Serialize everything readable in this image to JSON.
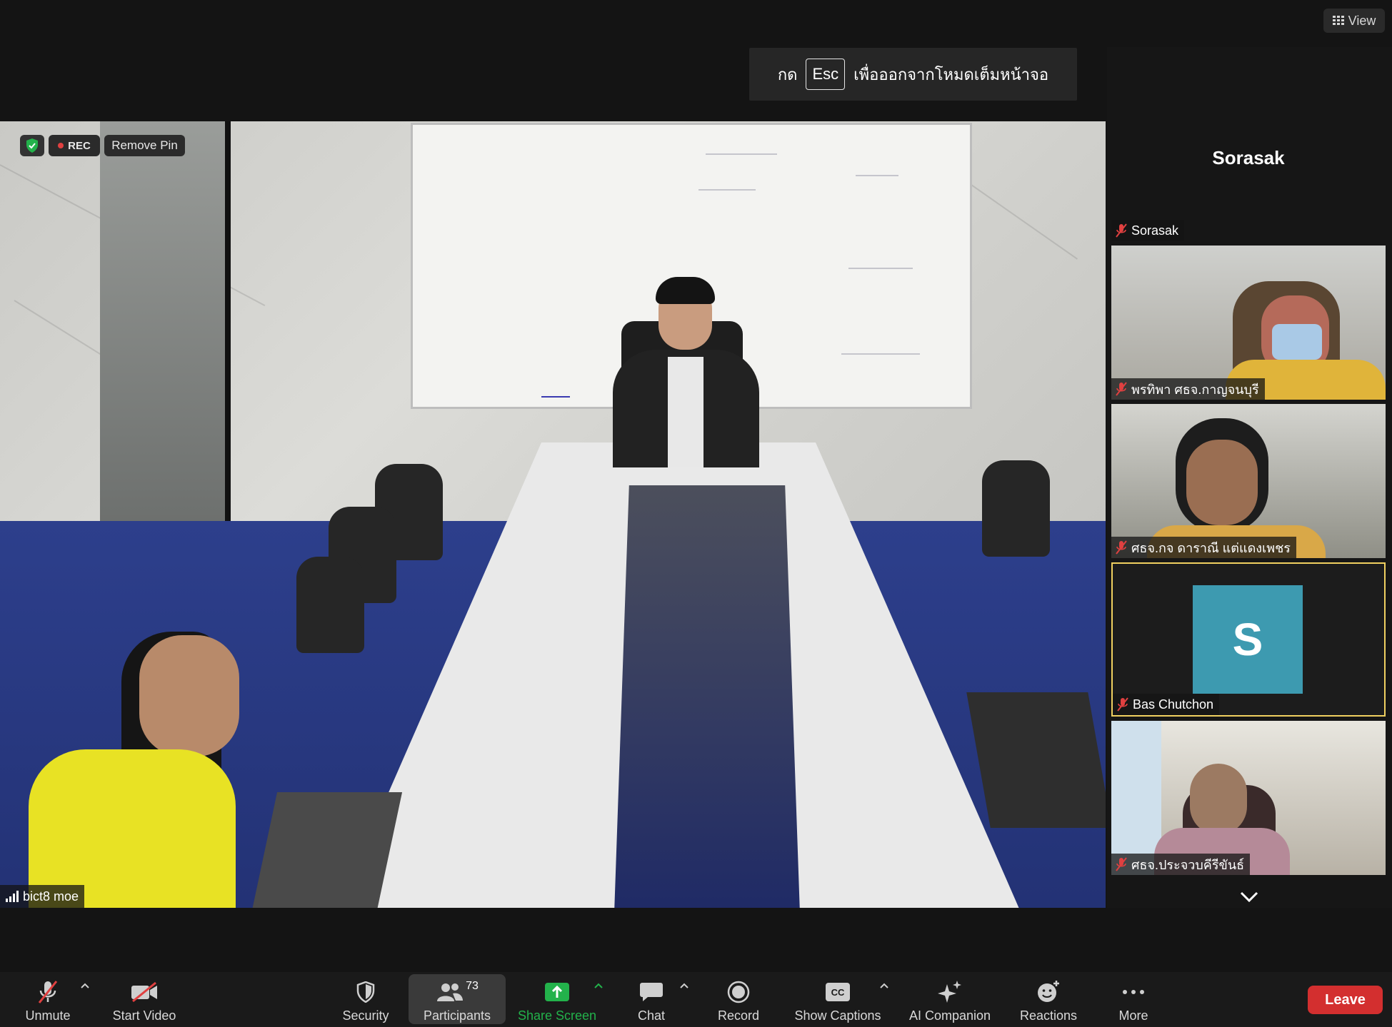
{
  "top": {
    "view_label": "View",
    "esc_banner": {
      "prefix": "กด",
      "key": "Esc",
      "suffix": "เพื่อออกจากโหมดเต็มหน้าจอ"
    }
  },
  "main_video": {
    "rec_label": "REC",
    "remove_pin_label": "Remove Pin",
    "participant_name": "bict8 moe"
  },
  "sidebar": {
    "active_speaker_title": "Sorasak",
    "tiles": [
      {
        "name": "Sorasak",
        "muted": true
      },
      {
        "name": "พรทิพา ศธจ.กาญจนบุรี",
        "muted": true
      },
      {
        "name": "ศธจ.กจ ดาราณี แต่แดงเพชร",
        "muted": true
      },
      {
        "name": "Bas Chutchon",
        "muted": true,
        "avatar_letter": "S"
      },
      {
        "name": "ศธจ.ประจวบคีรีขันธ์",
        "muted": true
      }
    ]
  },
  "toolbar": {
    "unmute": "Unmute",
    "start_video": "Start Video",
    "security": "Security",
    "participants": "Participants",
    "participants_count": "73",
    "share_screen": "Share Screen",
    "chat": "Chat",
    "record": "Record",
    "show_captions": "Show Captions",
    "ai_companion": "AI Companion",
    "reactions": "Reactions",
    "more": "More",
    "leave": "Leave"
  },
  "colors": {
    "accent_green": "#23b24b",
    "leave_red": "#d32f2f",
    "avatar_teal": "#3d9ab0",
    "mute_red": "#e04040"
  }
}
